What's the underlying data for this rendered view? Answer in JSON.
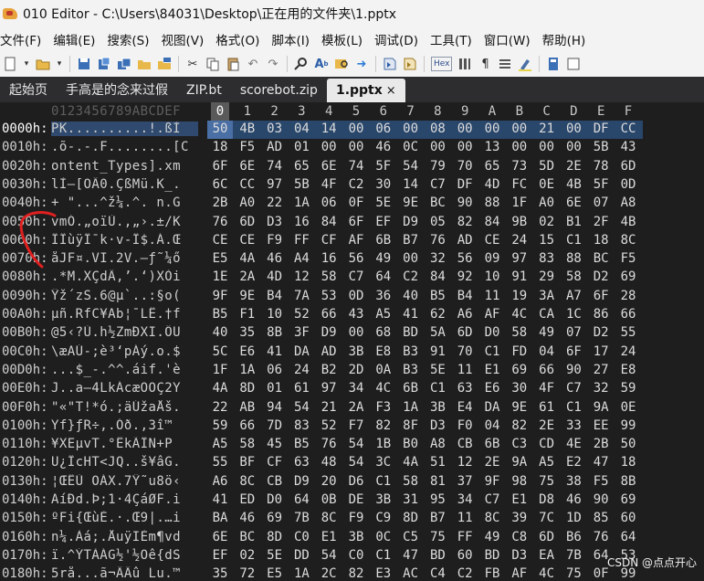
{
  "window": {
    "title": "010 Editor - C:\\Users\\84031\\Desktop\\正在用的文件夹\\1.pptx"
  },
  "menu": [
    "文件(F)",
    "编辑(E)",
    "搜索(S)",
    "视图(V)",
    "格式(O)",
    "脚本(I)",
    "模板(L)",
    "调试(D)",
    "工具(T)",
    "窗口(W)",
    "帮助(H)"
  ],
  "toolbar": {
    "hex_label": "Hex"
  },
  "tabs": [
    {
      "label": "起始页",
      "active": false
    },
    {
      "label": "手高是的念来过假",
      "active": false
    },
    {
      "label": "ZIP.bt",
      "active": false
    },
    {
      "label": "scorebot.zip",
      "active": false
    },
    {
      "label": "1.pptx",
      "active": true,
      "close": "×"
    }
  ],
  "editor": {
    "ascii_header": "0123456789ABCDEF",
    "columns": [
      "0",
      "1",
      "2",
      "3",
      "4",
      "5",
      "6",
      "7",
      "8",
      "9",
      "A",
      "B",
      "C",
      "D",
      "E",
      "F"
    ],
    "rows": [
      {
        "addr": "0000h:",
        "ascii": "PK..........!.ßÌ",
        "bytes": [
          "50",
          "4B",
          "03",
          "04",
          "14",
          "00",
          "06",
          "00",
          "08",
          "00",
          "00",
          "00",
          "21",
          "00",
          "DF",
          "CC"
        ]
      },
      {
        "addr": "0010h:",
        "ascii": ".õ-.-.F........[C",
        "bytes": [
          "18",
          "F5",
          "AD",
          "01",
          "00",
          "00",
          "46",
          "0C",
          "00",
          "00",
          "13",
          "00",
          "00",
          "00",
          "5B",
          "43"
        ]
      },
      {
        "addr": "0020h:",
        "ascii": "ontent_Types].xm",
        "bytes": [
          "6F",
          "6E",
          "74",
          "65",
          "6E",
          "74",
          "5F",
          "54",
          "79",
          "70",
          "65",
          "73",
          "5D",
          "2E",
          "78",
          "6D"
        ]
      },
      {
        "addr": "0030h:",
        "ascii": "lÌ—[OÂ0.ÇßMü.K_.",
        "bytes": [
          "6C",
          "CC",
          "97",
          "5B",
          "4F",
          "C2",
          "30",
          "14",
          "C7",
          "DF",
          "4D",
          "FC",
          "0E",
          "4B",
          "5F",
          "0D"
        ]
      },
      {
        "addr": "0040h:",
        "ascii": "+ \"...^ž¼.^. n.G",
        "bytes": [
          "2B",
          "A0",
          "22",
          "1A",
          "06",
          "0F",
          "5E",
          "9E",
          "BC",
          "90",
          "88",
          "1F",
          "A0",
          "6E",
          "07",
          "A8"
        ]
      },
      {
        "addr": "0050h:",
        "ascii": "vmÓ.„oïÙ.,„›.±/K",
        "bytes": [
          "76",
          "6D",
          "D3",
          "16",
          "84",
          "6F",
          "EF",
          "D9",
          "05",
          "82",
          "84",
          "9B",
          "02",
          "B1",
          "2F",
          "4B"
        ]
      },
      {
        "addr": "0060h:",
        "ascii": "ÎÎùÿÏ¯k·v-Î$.Á.Œ",
        "bytes": [
          "CE",
          "CE",
          "F9",
          "FF",
          "CF",
          "AF",
          "6B",
          "B7",
          "76",
          "AD",
          "CE",
          "24",
          "15",
          "C1",
          "18",
          "8C"
        ]
      },
      {
        "addr": "0070h:",
        "ascii": "åJF¤.VI.2V.–ƒ˜¼ő",
        "bytes": [
          "E5",
          "4A",
          "46",
          "A4",
          "16",
          "56",
          "49",
          "00",
          "32",
          "56",
          "09",
          "97",
          "83",
          "88",
          "BC",
          "F5"
        ]
      },
      {
        "addr": "0080h:",
        "ascii": ".*M.XÇdÂ‚’.‘)XÒi",
        "bytes": [
          "1E",
          "2A",
          "4D",
          "12",
          "58",
          "C7",
          "64",
          "C2",
          "84",
          "92",
          "10",
          "91",
          "29",
          "58",
          "D2",
          "69"
        ]
      },
      {
        "addr": "0090h:",
        "ascii": "Ÿž´zS.6@µ`..:§o(",
        "bytes": [
          "9F",
          "9E",
          "B4",
          "7A",
          "53",
          "0D",
          "36",
          "40",
          "B5",
          "B4",
          "11",
          "19",
          "3A",
          "A7",
          "6F",
          "28"
        ]
      },
      {
        "addr": "00A0h:",
        "ascii": "µñ.RfC¥Ab¦¯LÊ.†f",
        "bytes": [
          "B5",
          "F1",
          "10",
          "52",
          "66",
          "43",
          "A5",
          "41",
          "62",
          "A6",
          "AF",
          "4C",
          "CA",
          "1C",
          "86",
          "66"
        ]
      },
      {
        "addr": "00B0h:",
        "ascii": "@5‹?Ù.h½ZmÐXI.ÔU",
        "bytes": [
          "40",
          "35",
          "8B",
          "3F",
          "D9",
          "00",
          "68",
          "BD",
          "5A",
          "6D",
          "D0",
          "58",
          "49",
          "07",
          "D2",
          "55"
        ]
      },
      {
        "addr": "00C0h:",
        "ascii": "\\æAÚ-;è³‘pÁý.o.$",
        "bytes": [
          "5C",
          "E6",
          "41",
          "DA",
          "AD",
          "3B",
          "E8",
          "B3",
          "91",
          "70",
          "C1",
          "FD",
          "04",
          "6F",
          "17",
          "24"
        ]
      },
      {
        "addr": "00D0h:",
        "ascii": "...$_-.^^.áif.'è",
        "bytes": [
          "1F",
          "1A",
          "06",
          "24",
          "B2",
          "2D",
          "0A",
          "B3",
          "5E",
          "11",
          "E1",
          "69",
          "66",
          "90",
          "27",
          "E8"
        ]
      },
      {
        "addr": "00E0h:",
        "ascii": "J..a—4LkÁcæOOÇ2Y",
        "bytes": [
          "4A",
          "8D",
          "01",
          "61",
          "97",
          "34",
          "4C",
          "6B",
          "C1",
          "63",
          "E6",
          "30",
          "4F",
          "C7",
          "32",
          "59"
        ]
      },
      {
        "addr": "00F0h:",
        "ascii": "\"«\"T!*ó.;äÚžaÅš.",
        "bytes": [
          "22",
          "AB",
          "94",
          "54",
          "21",
          "2A",
          "F3",
          "1A",
          "3B",
          "E4",
          "DA",
          "9E",
          "61",
          "C1",
          "9A",
          "0E"
        ]
      },
      {
        "addr": "0100h:",
        "ascii": "Yf}ƒR÷,.Óð.,3î™",
        "bytes": [
          "59",
          "66",
          "7D",
          "83",
          "52",
          "F7",
          "82",
          "8F",
          "D3",
          "F0",
          "04",
          "82",
          "2E",
          "33",
          "EE",
          "99"
        ]
      },
      {
        "addr": "0110h:",
        "ascii": "¥XEµvT.°ËkÃÏN+P",
        "bytes": [
          "A5",
          "58",
          "45",
          "B5",
          "76",
          "54",
          "1B",
          "B0",
          "A8",
          "CB",
          "6B",
          "C3",
          "CD",
          "4E",
          "2B",
          "50"
        ]
      },
      {
        "addr": "0120h:",
        "ascii": "U¿ÏcHT<JQ..š¥âG.",
        "bytes": [
          "55",
          "BF",
          "CF",
          "63",
          "48",
          "54",
          "3C",
          "4A",
          "51",
          "12",
          "2E",
          "9A",
          "A5",
          "E2",
          "47",
          "18"
        ]
      },
      {
        "addr": "0130h:",
        "ascii": "¦ŒËÙ ÖÁX.7Ÿ˜u8ö‹",
        "bytes": [
          "A6",
          "8C",
          "CB",
          "D9",
          "20",
          "D6",
          "C1",
          "58",
          "81",
          "37",
          "9F",
          "98",
          "75",
          "38",
          "F5",
          "8B"
        ]
      },
      {
        "addr": "0140h:",
        "ascii": "AíÐd.Þ;1·4ÇáØF.i",
        "bytes": [
          "41",
          "ED",
          "D0",
          "64",
          "0B",
          "DE",
          "3B",
          "31",
          "95",
          "34",
          "C7",
          "E1",
          "D8",
          "46",
          "90",
          "69"
        ]
      },
      {
        "addr": "0150h:",
        "ascii": "ºFi{ŒùÈ.·.Œ9|.…i",
        "bytes": [
          "BA",
          "46",
          "69",
          "7B",
          "8C",
          "F9",
          "C9",
          "8D",
          "B7",
          "11",
          "8C",
          "39",
          "7C",
          "1D",
          "85",
          "60"
        ]
      },
      {
        "addr": "0160h:",
        "ascii": "n¼.Àá;.ÅuÿIÈm¶vd",
        "bytes": [
          "6E",
          "BC",
          "8D",
          "C0",
          "E1",
          "3B",
          "0C",
          "C5",
          "75",
          "FF",
          "49",
          "C8",
          "6D",
          "B6",
          "76",
          "64"
        ]
      },
      {
        "addr": "0170h:",
        "ascii": "ï.^ÝTÀÁG½'½Öê{dS",
        "bytes": [
          "EF",
          "02",
          "5E",
          "DD",
          "54",
          "C0",
          "C1",
          "47",
          "BD",
          "60",
          "BD",
          "D3",
          "EA",
          "7B",
          "64",
          "53"
        ]
      },
      {
        "addr": "0180h:",
        "ascii": "5rå...ã¬ÄÂû Lu.™",
        "bytes": [
          "35",
          "72",
          "E5",
          "1A",
          "2C",
          "82",
          "E3",
          "AC",
          "C4",
          "C2",
          "FB",
          "AF",
          "4C",
          "75",
          "0F",
          "99"
        ]
      }
    ]
  },
  "watermark": "CSDN @点点开心"
}
